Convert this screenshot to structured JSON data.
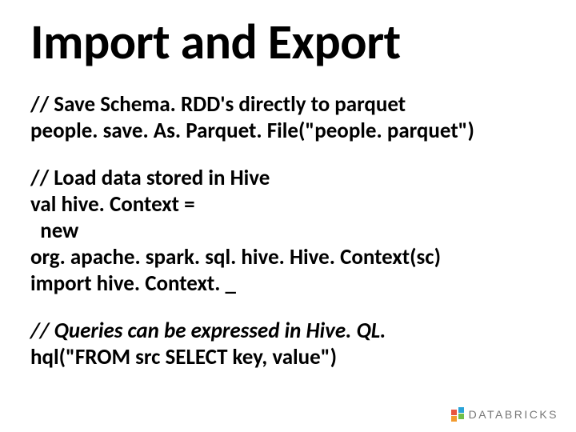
{
  "title": "Import and Export",
  "block1": {
    "comment": "// Save Schema. RDD's directly to parquet",
    "code": "people. save. As. Parquet. File(\"people. parquet\")"
  },
  "block2": {
    "comment": "// Load data stored in Hive",
    "line1": "val hive. Context =",
    "line2": "  new",
    "line3": "org. apache. spark. sql. hive. Hive. Context(sc)",
    "line4": "import hive. Context. _"
  },
  "block3": {
    "comment": "// Queries can be expressed in Hive. QL.",
    "code": "hql(\"FROM src SELECT key, value\")"
  },
  "logo": "DATABRICKS"
}
